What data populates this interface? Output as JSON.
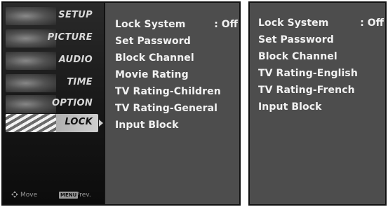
{
  "left_panel": {
    "sidebar": {
      "items": [
        {
          "label": "SETUP"
        },
        {
          "label": "PICTURE"
        },
        {
          "label": "AUDIO"
        },
        {
          "label": "TIME"
        },
        {
          "label": "OPTION"
        },
        {
          "label": "LOCK",
          "active": true
        }
      ],
      "footer": {
        "move_label": "Move",
        "menu_key": "MENU",
        "prev_label": "Prev."
      }
    },
    "menu": {
      "items": [
        {
          "label": "Lock System",
          "value": ": Off"
        },
        {
          "label": "Set Password"
        },
        {
          "label": "Block Channel"
        },
        {
          "label": "Movie Rating"
        },
        {
          "label": "TV Rating-Children"
        },
        {
          "label": "TV Rating-General"
        },
        {
          "label": "Input Block"
        }
      ]
    }
  },
  "right_panel": {
    "menu": {
      "items": [
        {
          "label": "Lock System",
          "value": ": Off"
        },
        {
          "label": "Set Password"
        },
        {
          "label": "Block Channel"
        },
        {
          "label": "TV Rating-English"
        },
        {
          "label": "TV Rating-French"
        },
        {
          "label": "Input Block"
        }
      ]
    }
  },
  "colors": {
    "menu_background": "#4d4d4d",
    "sidebar_background": "#151515",
    "active_highlight": "#cfcfcf",
    "text": "#f2f2f2"
  },
  "icons": {
    "move": "move-arrows-icon",
    "menu_key": "menu-key-icon",
    "active_arrow": "chevron-right-icon"
  }
}
